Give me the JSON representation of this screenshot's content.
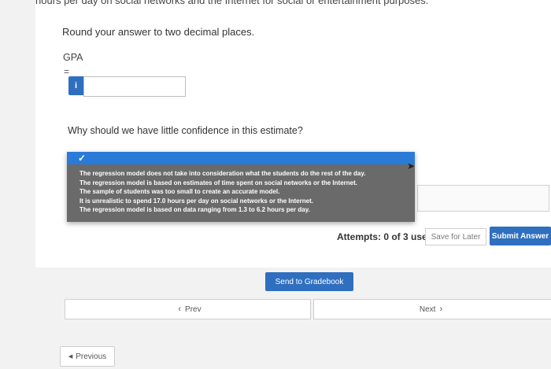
{
  "question": {
    "top_text": "hours per day on social networks and the Internet for social or entertainment purposes.",
    "round_instruction": "Round your answer to two decimal places.",
    "gpa_label": "GPA",
    "equals": "=",
    "info_icon": "i",
    "answer_value": "",
    "confidence_question": "Why should we have little confidence in this estimate?"
  },
  "dropdown": {
    "selected_mark": "✓",
    "options": [
      "The regression model does not take into consideration what the students do the rest of the day.",
      "The regression model is based on estimates of time spent on social networks or the Internet.",
      "The sample of students was too small to create an accurate model.",
      "It is unrealistic to spend 17.0 hours per day on social networks or the Internet.",
      "The regression model is based on data ranging from 1.3 to 6.2 hours per day."
    ]
  },
  "footer": {
    "attempts": "Attempts: 0 of 3 used",
    "save_label": "Save for Later",
    "submit_label": "Submit Answer",
    "gradebook_label": "Send to Gradebook",
    "prev_label": "Prev",
    "next_label": "Next",
    "previous_label": "Previous"
  },
  "icons": {
    "info": "info-icon",
    "check": "check-icon",
    "chevron_left": "chevron-left-icon",
    "chevron_right": "chevron-right-icon",
    "triangle_left": "triangle-left-icon"
  },
  "colors": {
    "accent": "#2f6fc0",
    "dropdown_bg": "#6a6a6a",
    "dropdown_selected": "#2a7bd8"
  }
}
